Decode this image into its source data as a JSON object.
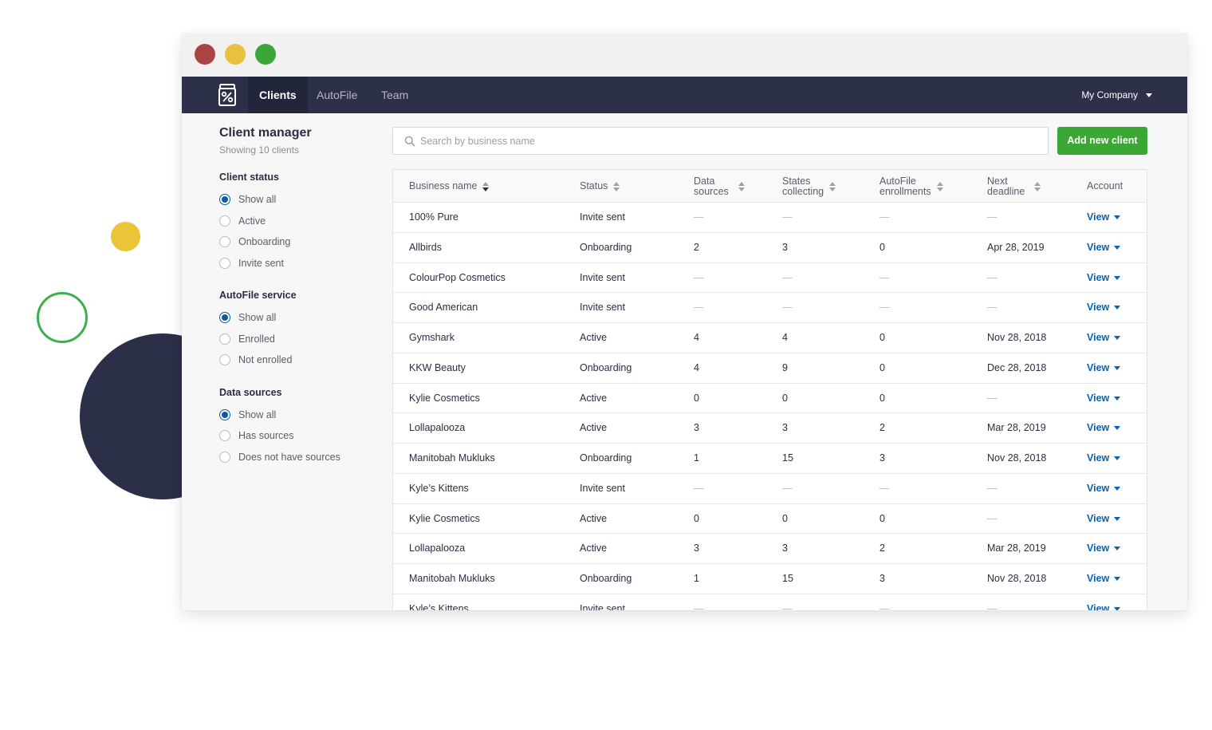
{
  "nav": {
    "logo_icon": "jar-percent-logo-icon",
    "tabs": [
      {
        "label": "Clients",
        "active": true
      },
      {
        "label": "AutoFile",
        "active": false
      },
      {
        "label": "Team",
        "active": false
      }
    ],
    "company": "My Company"
  },
  "sidebar": {
    "title": "Client manager",
    "subtitle": "Showing 10 clients",
    "groups": [
      {
        "title": "Client status",
        "options": [
          "Show all",
          "Active",
          "Onboarding",
          "Invite sent"
        ],
        "selected": 0
      },
      {
        "title": "AutoFile service",
        "options": [
          "Show all",
          "Enrolled",
          "Not enrolled"
        ],
        "selected": 0
      },
      {
        "title": "Data sources",
        "options": [
          "Show all",
          "Has sources",
          "Does not have sources"
        ],
        "selected": 0
      }
    ]
  },
  "search": {
    "placeholder": "Search by business name",
    "value": ""
  },
  "add_button": "Add new client",
  "table": {
    "headers": {
      "business": "Business name",
      "status": "Status",
      "data_sources": [
        "Data",
        "sources"
      ],
      "states": [
        "States",
        "collecting"
      ],
      "autofile": [
        "AutoFile",
        "enrollments"
      ],
      "deadline": [
        "Next",
        "deadline"
      ],
      "account": "Account"
    },
    "view_label": "View",
    "rows": [
      [
        "100% Pure",
        "Invite sent",
        "—",
        "—",
        "—",
        "—"
      ],
      [
        "Allbirds",
        "Onboarding",
        "2",
        "3",
        "0",
        "Apr 28, 2019"
      ],
      [
        "ColourPop Cosmetics",
        "Invite sent",
        "—",
        "—",
        "—",
        "—"
      ],
      [
        "Good American",
        "Invite sent",
        "—",
        "—",
        "—",
        "—"
      ],
      [
        "Gymshark",
        "Active",
        "4",
        "4",
        "0",
        "Nov 28, 2018"
      ],
      [
        "KKW Beauty",
        "Onboarding",
        "4",
        "9",
        "0",
        "Dec 28, 2018"
      ],
      [
        "Kylie Cosmetics",
        "Active",
        "0",
        "0",
        "0",
        "—"
      ],
      [
        "Lollapalooza",
        "Active",
        "3",
        "3",
        "2",
        "Mar 28, 2019"
      ],
      [
        "Manitobah Mukluks",
        "Onboarding",
        "1",
        "15",
        "3",
        "Nov 28, 2018"
      ],
      [
        "Kyle’s Kittens",
        "Invite sent",
        "—",
        "—",
        "—",
        "—"
      ],
      [
        "Kylie Cosmetics",
        "Active",
        "0",
        "0",
        "0",
        "—"
      ],
      [
        "Lollapalooza",
        "Active",
        "3",
        "3",
        "2",
        "Mar 28, 2019"
      ],
      [
        "Manitobah Mukluks",
        "Onboarding",
        "1",
        "15",
        "3",
        "Nov 28, 2018"
      ],
      [
        "Kyle’s Kittens",
        "Invite sent",
        "—",
        "—",
        "—",
        "—"
      ]
    ]
  }
}
